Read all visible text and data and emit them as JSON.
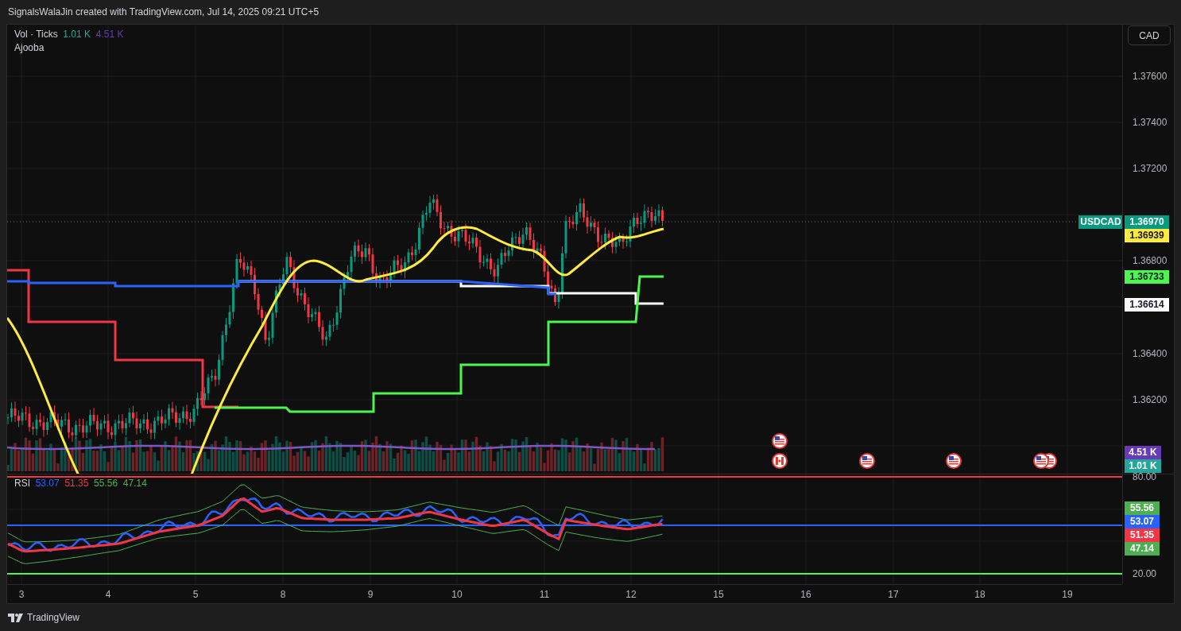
{
  "header": {
    "text": "SignalsWalaJin created with TradingView.com, Jul 14, 2025 09:21 UTC+5"
  },
  "legend": {
    "label": "Vol · Ticks",
    "values": [
      {
        "text": "1.01 K",
        "color": "#26a69a"
      },
      {
        "text": "4.51 K",
        "color": "#673ab7"
      }
    ],
    "indicator": "Ajooba"
  },
  "currency_button": "CAD",
  "price_axis": {
    "ticks": [
      "1.37600",
      "1.37400",
      "1.37200",
      "1.36800",
      "1.36400",
      "1.36200"
    ]
  },
  "price_badges": [
    {
      "symbol": "USDCAD",
      "text": "1.36970",
      "color": "#089981"
    },
    {
      "text": "1.36939",
      "color": "#ffeb3b"
    },
    {
      "text": "1.36733",
      "color": "#4cf550"
    },
    {
      "text": "1.36614",
      "color": "#ffffff"
    }
  ],
  "volume_badges": [
    {
      "text": "4.51 K",
      "color": "#673ab7"
    },
    {
      "text": "1.01 K",
      "color": "#26a69a"
    }
  ],
  "rsi": {
    "label": "RSI",
    "values": [
      {
        "text": "53.07",
        "color": "#2962ff"
      },
      {
        "text": "51.35",
        "color": "#f23645"
      },
      {
        "text": "55.56",
        "color": "#4caf50"
      },
      {
        "text": "47.14",
        "color": "#4caf50"
      }
    ],
    "axis_ticks": [
      "80.00",
      "20.00"
    ],
    "badges": [
      {
        "text": "55.56",
        "color": "#4caf50"
      },
      {
        "text": "53.07",
        "color": "#2962ff"
      },
      {
        "text": "51.35",
        "color": "#f23645"
      },
      {
        "text": "47.14",
        "color": "#4caf50"
      }
    ]
  },
  "time_axis": [
    "3",
    "4",
    "5",
    "8",
    "9",
    "10",
    "11",
    "12",
    "15",
    "16",
    "17",
    "18",
    "19"
  ],
  "footer": {
    "brand": "TradingView"
  }
}
